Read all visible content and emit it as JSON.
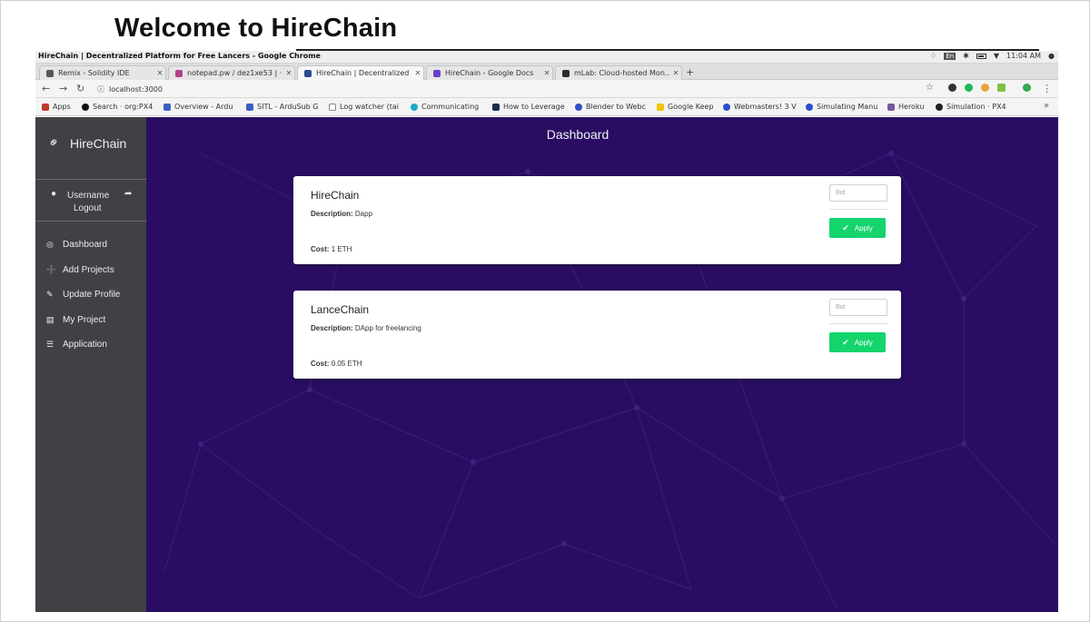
{
  "slide": {
    "heading": "Welcome to HireChain"
  },
  "os": {
    "window_title": "HireChain | Decentralized Platform for Free Lancers - Google Chrome",
    "keyboard_layout": "En",
    "clock": "11:04 AM"
  },
  "browser": {
    "tabs": [
      {
        "label": "Remix - Solidity IDE",
        "color": "#555555"
      },
      {
        "label": "notepad.pw / dez1xe53 | ·",
        "color": "#b0408a"
      },
      {
        "label": "HireChain | Decentralized",
        "color": "#2b4d8c"
      },
      {
        "label": "HireChain - Google Docs",
        "color": "#6a3fc9"
      },
      {
        "label": "mLab: Cloud-hosted Mon…",
        "color": "#2b2b2b"
      }
    ],
    "new_tab": "+",
    "url": "localhost:3000",
    "bookmarks": [
      {
        "label": "Apps",
        "color": "#c0392b"
      },
      {
        "label": "Search · org:PX4",
        "color": "#111111"
      },
      {
        "label": "Overview - Ardu",
        "color": "#3b5fc0"
      },
      {
        "label": "SITL - ArduSub G",
        "color": "#3b5fc0"
      },
      {
        "label": "Log watcher (tai",
        "color": "#888888"
      },
      {
        "label": "Communicating",
        "color": "#1fa8c9"
      },
      {
        "label": "How to Leverage",
        "color": "#1a2b4c"
      },
      {
        "label": "Blender to Webc",
        "color": "#2d4fc7"
      },
      {
        "label": "Google Keep",
        "color": "#f4c20d"
      },
      {
        "label": "Webmasters! 3 V",
        "color": "#2d4fc7"
      },
      {
        "label": "Simulating Manu",
        "color": "#2d4fc7"
      },
      {
        "label": "Heroku",
        "color": "#79589f"
      },
      {
        "label": "Simulation · PX4",
        "color": "#222222"
      }
    ],
    "more": "»"
  },
  "sidebar": {
    "brand": "HireChain",
    "username": "Username",
    "logout": "Logout",
    "items": [
      {
        "label": "Dashboard",
        "icon": "dashboard-icon",
        "glyph": "◎"
      },
      {
        "label": "Add Projects",
        "icon": "plus-circle-icon",
        "glyph": "➕"
      },
      {
        "label": "Update Profile",
        "icon": "pencil-icon",
        "glyph": "✎"
      },
      {
        "label": "My Project",
        "icon": "briefcase-icon",
        "glyph": "▤"
      },
      {
        "label": "Application",
        "icon": "list-icon",
        "glyph": "☰"
      }
    ]
  },
  "main": {
    "title": "Dashboard",
    "projects": [
      {
        "title": "HireChain",
        "description_label": "Description:",
        "description": "Dapp",
        "cost_label": "Cost:",
        "cost": "1 ETH",
        "bid_placeholder": "Bid",
        "apply_label": "Apply"
      },
      {
        "title": "LanceChain",
        "description_label": "Description:",
        "description": "DApp for freelancing",
        "cost_label": "Cost:",
        "cost": "0.05 ETH",
        "bid_placeholder": "Bid",
        "apply_label": "Apply"
      }
    ]
  },
  "colors": {
    "main_background": "#2a0d63",
    "sidebar_background": "#3f4144",
    "apply_button": "#14d46c"
  }
}
